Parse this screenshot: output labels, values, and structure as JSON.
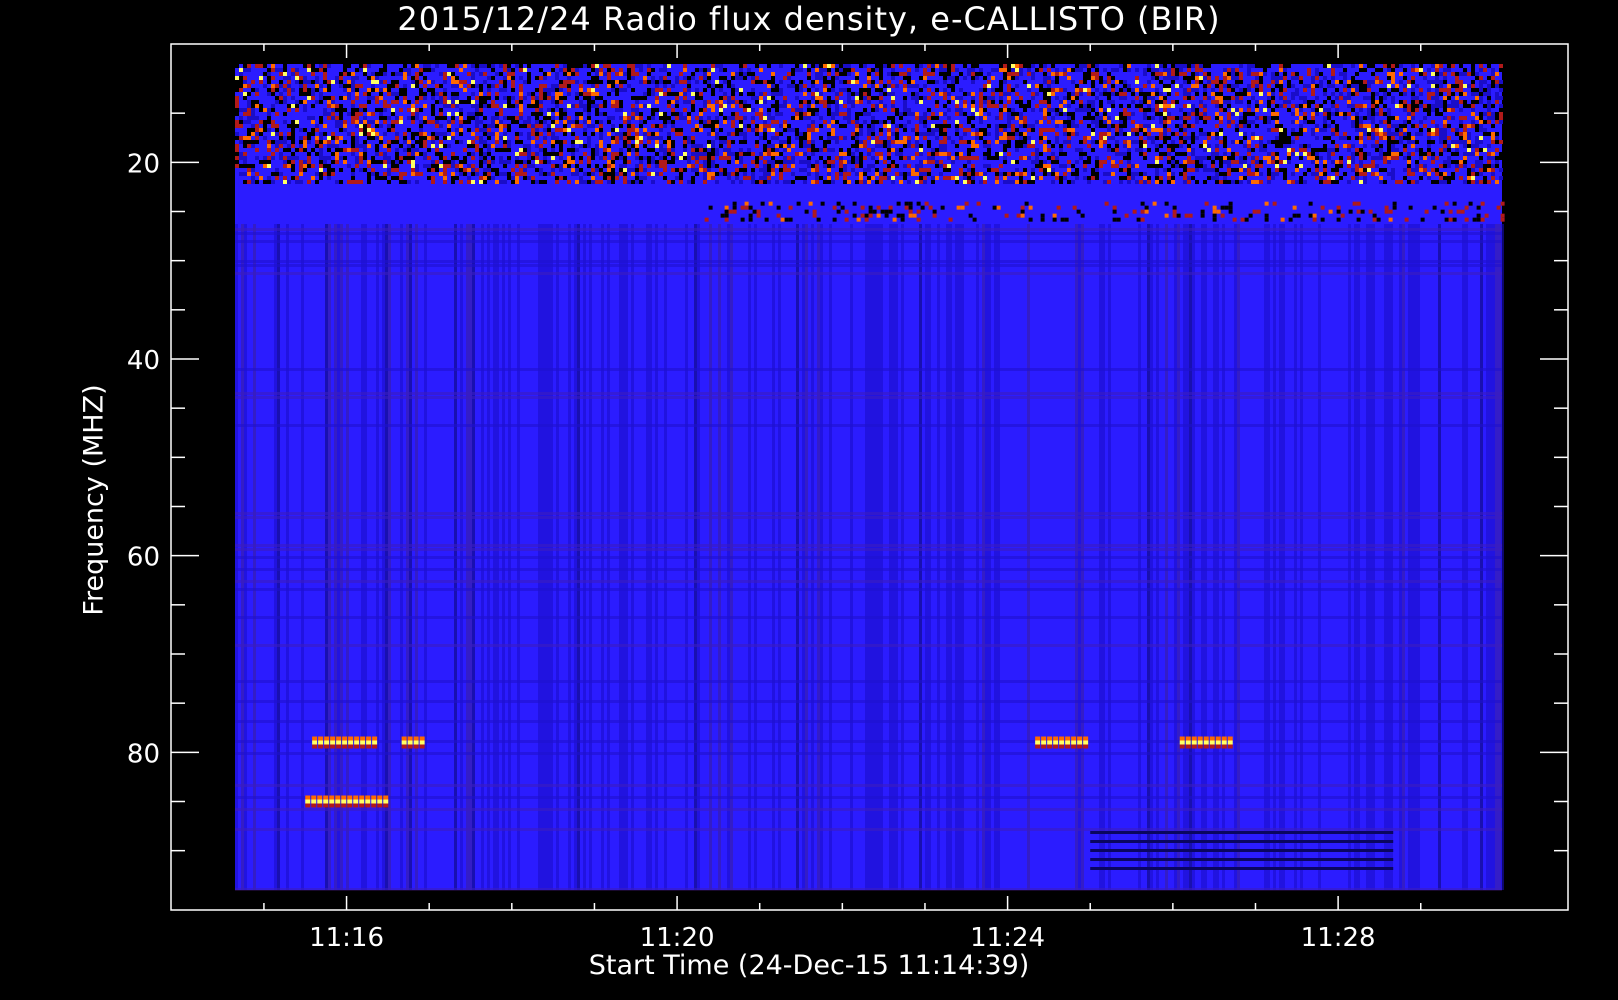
{
  "chart_data": {
    "type": "heatmap",
    "title": "2015/12/24  Radio flux density, e-CALLISTO (BIR)",
    "xlabel": "Start Time (24-Dec-15 11:14:39)",
    "ylabel": "Frequency (MHZ)",
    "x_tick_labels": [
      "11:16",
      "11:20",
      "11:24",
      "11:28"
    ],
    "y_tick_labels": [
      "20",
      "40",
      "60",
      "80"
    ],
    "y_reversed": true,
    "colormap": [
      "#000000",
      "#1a0dc8",
      "#2b1cff",
      "#b01a1a",
      "#ff6a00",
      "#ffff66",
      "#ffffff"
    ],
    "data_extent": {
      "time_start": "11:14:39",
      "time_end": "11:29:59",
      "freq_top_mhz": 10,
      "freq_bottom_mhz": 94
    },
    "features": [
      {
        "kind": "rfi_band",
        "freq_mhz": [
          10,
          22
        ],
        "time": [
          "11:14:39",
          "11:29:59"
        ],
        "intensity": "high"
      },
      {
        "kind": "rfi_band",
        "freq_mhz": [
          24,
          26
        ],
        "time": [
          "11:20:20",
          "11:29:59"
        ],
        "intensity": "medium"
      },
      {
        "kind": "burst",
        "freq_mhz": 79,
        "time": [
          "11:15:35",
          "11:16:20"
        ]
      },
      {
        "kind": "burst",
        "freq_mhz": 79,
        "time": [
          "11:16:40",
          "11:16:55"
        ]
      },
      {
        "kind": "burst",
        "freq_mhz": 85,
        "time": [
          "11:15:30",
          "11:16:30"
        ]
      },
      {
        "kind": "burst",
        "freq_mhz": 79,
        "time": [
          "11:24:20",
          "11:24:55"
        ]
      },
      {
        "kind": "burst",
        "freq_mhz": 79,
        "time": [
          "11:26:05",
          "11:26:40"
        ]
      },
      {
        "kind": "dark_band",
        "freq_mhz": [
          88,
          92
        ],
        "time": [
          "11:25:00",
          "11:28:40"
        ]
      }
    ]
  }
}
